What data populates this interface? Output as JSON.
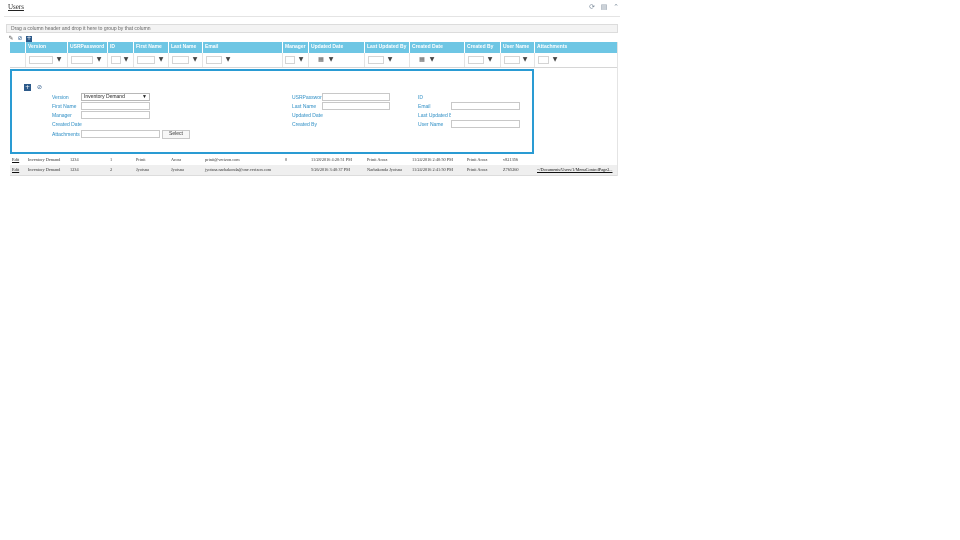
{
  "window": {
    "title": "Users"
  },
  "toolbar": {
    "icons": [
      "refresh-icon",
      "export-icon",
      "collapse-icon"
    ]
  },
  "group_panel": {
    "text": "Drag a column header and drop it here to group by that column"
  },
  "grid_tools": {
    "icons": [
      "edit-icon",
      "cancel-icon",
      "add-icon"
    ]
  },
  "columns": [
    "Version",
    "USRPassword",
    "ID",
    "First Name",
    "Last Name",
    "Email",
    "Manager",
    "Updated Date",
    "Last Updated By",
    "Created Date",
    "Created By",
    "User Name",
    "Attachments"
  ],
  "form": {
    "labels": {
      "version": "Version",
      "first_name": "First Name",
      "manager": "Manager",
      "created_date": "Created Date",
      "attachments": "Attachments",
      "usrpassword": "USRPassword",
      "last_name": "Last Name",
      "updated_date": "Updated Date",
      "created_by": "Created By",
      "id": "ID",
      "email": "Email",
      "last_updated_by": "Last Updated By",
      "user_name": "User Name"
    },
    "version_value": "Inventory Demand",
    "select_button": "Select"
  },
  "rows": [
    {
      "edit": "Edit",
      "version": "Inventory Demand",
      "usrpassword": "1234",
      "id": "1",
      "first_name": "Prinit",
      "last_name": "Arora",
      "email": "prinit@verizon.com",
      "manager": "0",
      "updated_date": "11/28/2016 4:20:51 PM",
      "last_updated_by": "Prinit Arora",
      "created_date": "11/24/2016 2:40:50 PM",
      "created_by": "Prinit Arora",
      "user_name": "v821356",
      "attachments": ""
    },
    {
      "edit": "Edit",
      "version": "Inventory Demand",
      "usrpassword": "1234",
      "id": "2",
      "first_name": "Jyotsna",
      "last_name": "Jyotsna",
      "email": "jyotsna.narbakonda@one.verizon.com",
      "manager": "",
      "updated_date": "5/26/2016 3:40:37 PM",
      "last_updated_by": "Narbakonda Jyotsna",
      "created_date": "11/24/2016 2:41:50 PM",
      "created_by": "Prinit Arora",
      "user_name": "Z765260",
      "attachments": "~/Documents/Users/1/MenuControlPage2..."
    }
  ],
  "colors": {
    "header_bg": "#6ec6e4",
    "form_border": "#2a9bd3",
    "label": "#2a8cc4"
  }
}
